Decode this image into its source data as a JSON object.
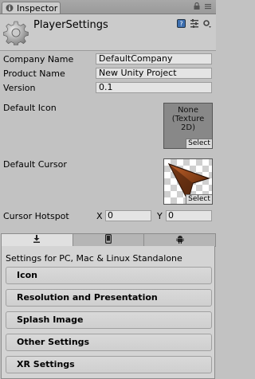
{
  "window": {
    "tab_label": "Inspector",
    "tab_icon": "info-icon",
    "controls": [
      "lock-icon",
      "menu-icon"
    ]
  },
  "header": {
    "title": "PlayerSettings",
    "icon": "gear-icon",
    "buttons": [
      "help-icon",
      "preset-icon",
      "settings-menu-icon"
    ]
  },
  "properties": {
    "company_name": {
      "label": "Company Name",
      "value": "DefaultCompany"
    },
    "product_name": {
      "label": "Product Name",
      "value": "New Unity Project"
    },
    "version": {
      "label": "Version",
      "value": "0.1"
    },
    "default_icon": {
      "label": "Default Icon",
      "slot_text": "None\n(Texture\n2D)",
      "select_label": "Select"
    },
    "default_cursor": {
      "label": "Default Cursor",
      "select_label": "Select"
    },
    "cursor_hotspot": {
      "label": "Cursor Hotspot",
      "x_label": "X",
      "x_value": "0",
      "y_label": "Y",
      "y_value": "0"
    }
  },
  "platform_tabs": [
    {
      "icon": "standalone-download-icon",
      "active": true
    },
    {
      "icon": "mobile-phone-icon",
      "active": false
    },
    {
      "icon": "android-icon",
      "active": false
    }
  ],
  "settings_panel": {
    "title": "Settings for PC, Mac & Linux Standalone",
    "sections": [
      "Icon",
      "Resolution and Presentation",
      "Splash Image",
      "Other Settings",
      "XR Settings"
    ]
  },
  "colors": {
    "background": "#c2c2c2",
    "field": "#e4e4e4",
    "cursor_brown": "#7a3a14"
  }
}
